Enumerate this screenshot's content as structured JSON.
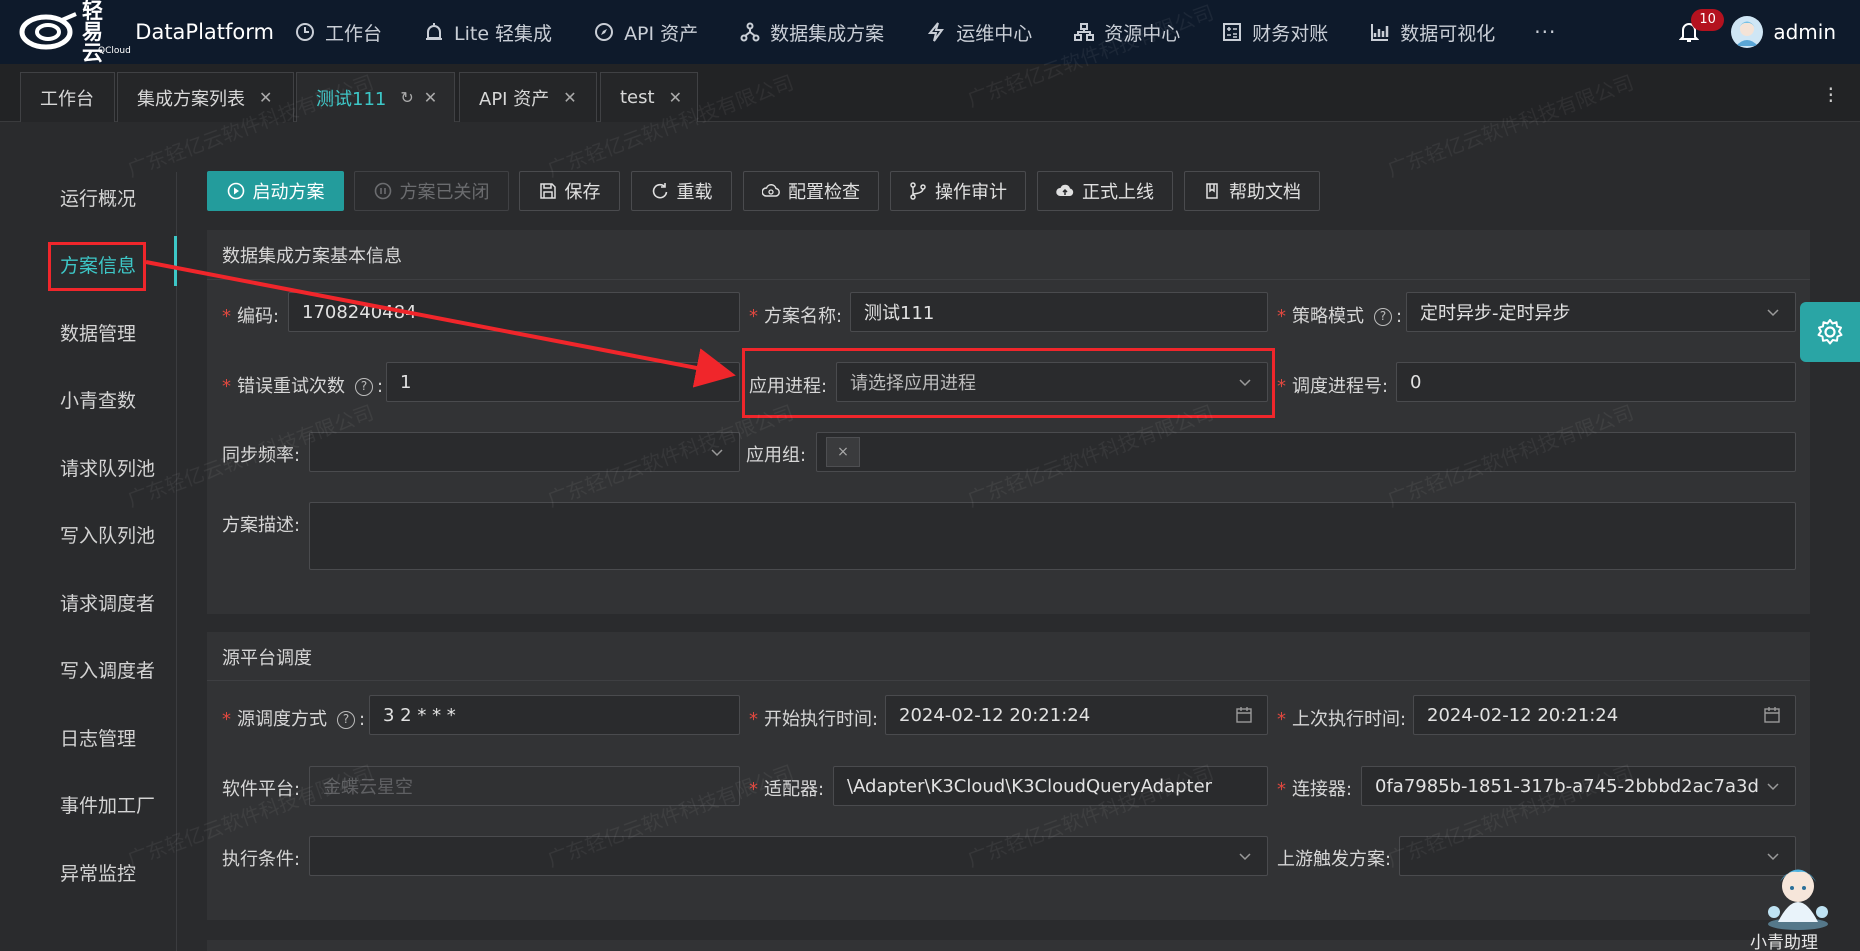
{
  "brand": {
    "logo_cn": "轻易云",
    "logo_en": "QCloud",
    "name": "DataPlatform"
  },
  "nav": {
    "items": [
      "工作台",
      "Lite 轻集成",
      "API 资产",
      "数据集成方案",
      "运维中心",
      "资源中心",
      "财务对账",
      "数据可视化"
    ],
    "more": "···",
    "notification_count": "10",
    "user": "admin"
  },
  "tabs": [
    {
      "label": "工作台"
    },
    {
      "label": "集成方案列表"
    },
    {
      "label": "测试111"
    },
    {
      "label": "API 资产"
    },
    {
      "label": "test"
    }
  ],
  "sidebar": {
    "items": [
      "运行概况",
      "方案信息",
      "数据管理",
      "小青查数",
      "请求队列池",
      "写入队列池",
      "请求调度者",
      "写入调度者",
      "日志管理",
      "事件加工厂",
      "异常监控"
    ],
    "active": "方案信息"
  },
  "toolbar": {
    "start": "启动方案",
    "closed": "方案已关闭",
    "save": "保存",
    "reload": "重载",
    "config_check": "配置检查",
    "audit": "操作审计",
    "go_live": "正式上线",
    "help_doc": "帮助文档"
  },
  "basic_info": {
    "title": "数据集成方案基本信息",
    "code_label": "编码",
    "code_value": "1708240484",
    "name_label": "方案名称",
    "name_value": "测试111",
    "strategy_label": "策略模式",
    "strategy_value": "定时异步-定时异步",
    "retry_label": "错误重试次数",
    "retry_value": "1",
    "process_label": "应用进程",
    "process_placeholder": "请选择应用进程",
    "schedule_no_label": "调度进程号",
    "schedule_no_value": "0",
    "sync_freq_label": "同步频率",
    "app_group_label": "应用组",
    "app_group_tag": "×",
    "desc_label": "方案描述"
  },
  "source": {
    "title": "源平台调度",
    "mode_label": "源调度方式",
    "mode_value": "3 2 * * *",
    "start_time_label": "开始执行时间",
    "start_time_value": "2024-02-12 20:21:24",
    "last_time_label": "上次执行时间",
    "last_time_value": "2024-02-12 20:21:24",
    "platform_label": "软件平台",
    "platform_value": "金蝶云星空",
    "adapter_label": "适配器",
    "adapter_value": "\\Adapter\\K3Cloud\\K3CloudQueryAdapter",
    "connector_label": "连接器",
    "connector_value": "0fa7985b-1851-317b-a745-2bbbd2ac7a3d",
    "condition_label": "执行条件",
    "upstream_label": "上游触发方案"
  },
  "assistant": {
    "label": "小青助理"
  },
  "watermark": "广东轻亿云软件科技有限公司",
  "colors": {
    "accent": "#239c9c",
    "highlight": "#f0262b",
    "nav_bg": "#0e1a2b"
  }
}
